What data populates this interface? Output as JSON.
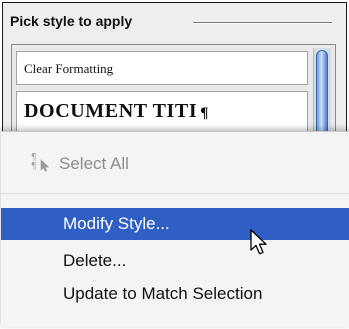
{
  "panel": {
    "title": "Pick style to apply"
  },
  "style_list": {
    "items": [
      {
        "label": "Clear Formatting"
      },
      {
        "label": "DOCUMENT TITI",
        "mark": "¶"
      }
    ]
  },
  "context_menu": {
    "items": [
      {
        "label": "Select All",
        "enabled": false,
        "icon": "select-all-pilcrow-icon"
      },
      {
        "label": "Modify Style...",
        "enabled": true,
        "highlighted": true
      },
      {
        "label": "Delete...",
        "enabled": true
      },
      {
        "label": "Update to Match Selection",
        "enabled": true
      }
    ]
  },
  "colors": {
    "highlight": "#2f5ec5",
    "scroll_thumb": "#6f9ad8",
    "disabled_text": "#8c8c8c"
  }
}
